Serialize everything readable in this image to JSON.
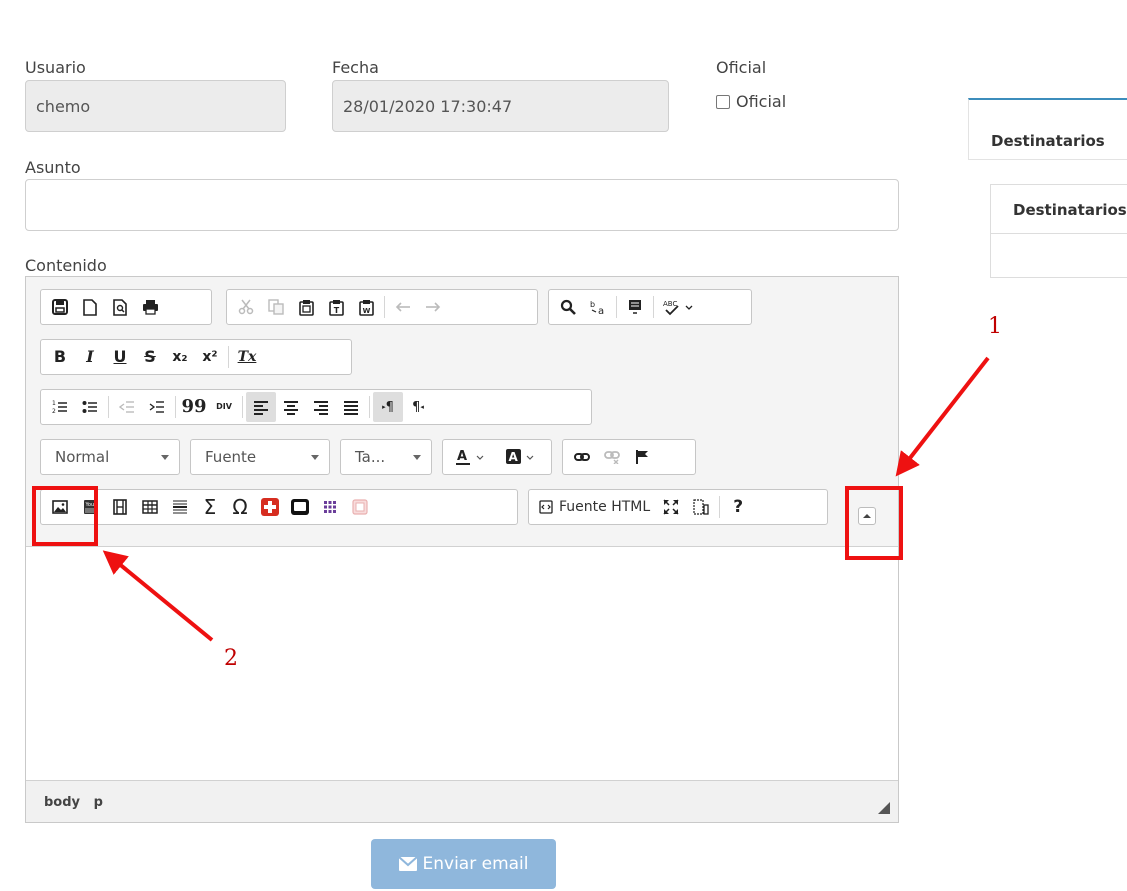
{
  "form": {
    "usuario_label": "Usuario",
    "usuario_value": "chemo",
    "fecha_label": "Fecha",
    "fecha_value": "28/01/2020 17:30:47",
    "oficial_label": "Oficial",
    "oficial_checkbox_label": "Oficial",
    "asunto_label": "Asunto",
    "asunto_value": "",
    "contenido_label": "Contenido"
  },
  "tabs": {
    "destinatarios": "Destinatarios"
  },
  "table": {
    "header": "Destinatarios"
  },
  "editor": {
    "combo_format": "Normal",
    "combo_font": "Fuente",
    "combo_size": "Ta...",
    "source_button": "Fuente HTML",
    "elementspath": [
      "body",
      "p"
    ],
    "glyphs": {
      "bold": "B",
      "italic": "I",
      "underline": "U",
      "strike": "S",
      "subscript": "x₂",
      "superscript": "x²",
      "remove_format": "Tx",
      "blockquote": "99",
      "div": "DIV",
      "about": "?",
      "paragraph": "¶",
      "omega": "Ω",
      "sigma": "Σ",
      "spell": "ABC"
    }
  },
  "annotations": {
    "one": "1",
    "two": "2"
  },
  "send_button": {
    "label": "Enviar email"
  },
  "colors": {
    "accent": "#3c8dbc",
    "annotation": "#e11111",
    "send_bg": "#8fb7dc"
  }
}
